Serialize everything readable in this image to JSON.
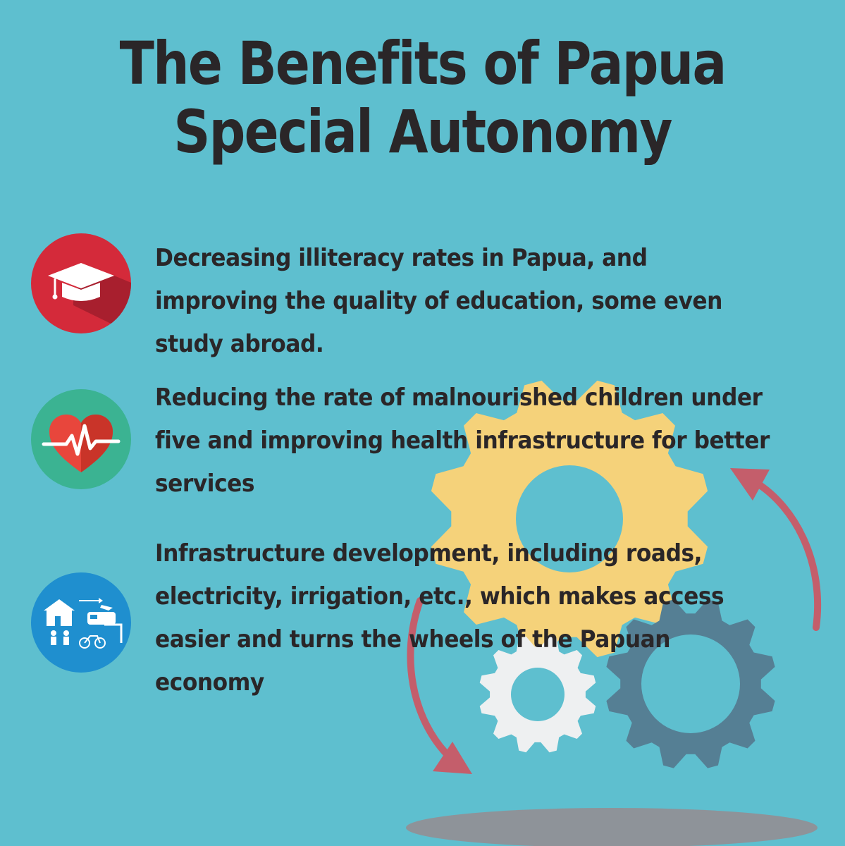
{
  "title": {
    "line1": "The Benefits of Papua",
    "line2": "Special Autonomy"
  },
  "benefits": [
    {
      "icon": "graduation-cap-icon",
      "color": "#d42a3a",
      "text": "Decreasing illiteracy rates in Papua, and improving the quality of education, some even study abroad."
    },
    {
      "icon": "heart-pulse-icon",
      "color": "#3bb392",
      "text": "Reducing the rate of malnourished children under five and improving health infrastructure for better services"
    },
    {
      "icon": "infrastructure-icon",
      "color": "#1f8fcf",
      "text": "Infrastructure development, including roads, electricity, irrigation, etc., which makes access easier and turns the wheels of the Papuan economy"
    }
  ],
  "colors": {
    "background": "#5ebfcf",
    "title_text": "#2a2628",
    "gear_large": "#f5d27a",
    "gear_small": "#eef0f1",
    "gear_dark": "#557f94",
    "arrow": "#c45e6b",
    "shadow": "#8e9399"
  }
}
